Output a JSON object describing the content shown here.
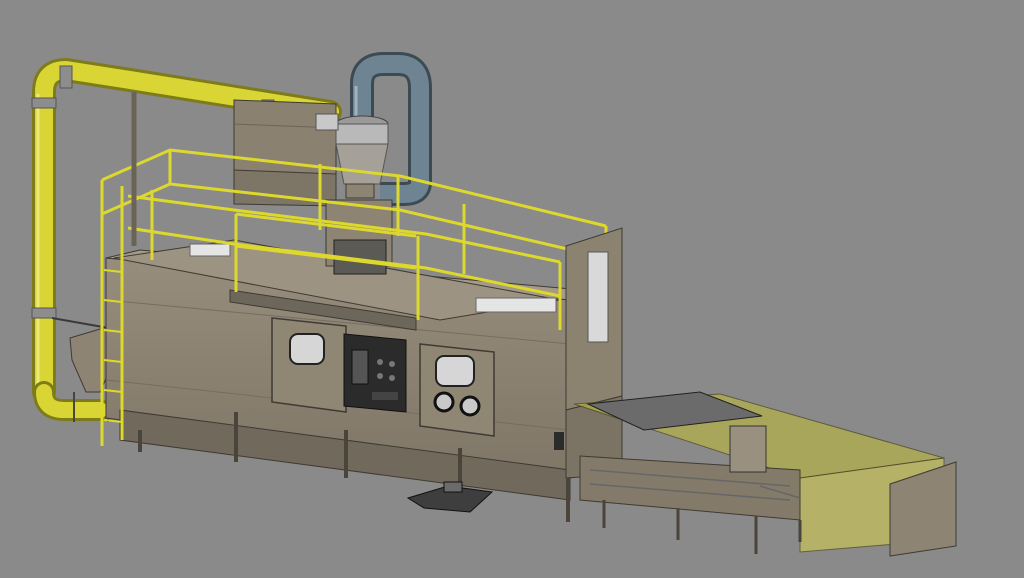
{
  "scene": {
    "colors": {
      "background": "#8a8a8a",
      "machine_body": "#8e8474",
      "machine_dark": "#5e574c",
      "machine_shadow": "#3f3a33",
      "duct_yellow": "#d4d230",
      "duct_yellow_dark": "#8f8d1d",
      "railing_yellow": "#e0dc2e",
      "blue_duct": "#6f8593",
      "blue_duct_dark": "#4c5d68",
      "dark_panel": "#2a2a2a",
      "conveyor_yellow_glass": "#c6c24a",
      "window_fill": "#cfcfcf"
    }
  }
}
